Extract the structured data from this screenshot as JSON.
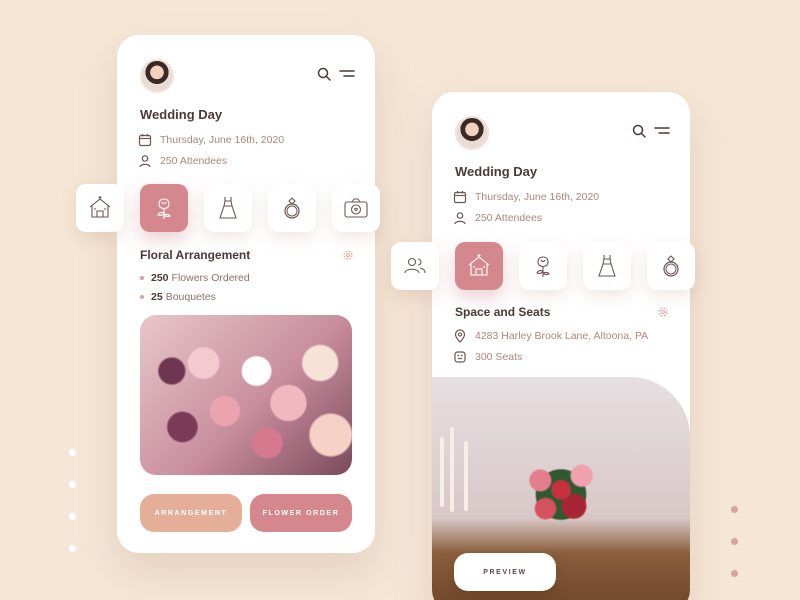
{
  "colors": {
    "background": "#f5e6d6",
    "accent_rose": "#d4888e",
    "accent_peach": "#e5ae98",
    "muted_text": "#a8877f"
  },
  "screen1": {
    "event_title": "Wedding Day",
    "date": "Thursday, June 16th, 2020",
    "attendees": "250 Attendees",
    "categories": [
      {
        "icon": "house-icon",
        "active": false
      },
      {
        "icon": "rose-icon",
        "active": true
      },
      {
        "icon": "dress-icon",
        "active": false
      },
      {
        "icon": "ring-icon",
        "active": false
      },
      {
        "icon": "camera-icon",
        "active": false
      }
    ],
    "section_title": "Floral Arrangement",
    "details": [
      {
        "count": "250",
        "label": "Flowers Ordered"
      },
      {
        "count": "25",
        "label": "Bouquetes"
      }
    ],
    "buttons": {
      "arrangement": "ARRANGEMENT",
      "flower_order": "FLOWER ORDER"
    }
  },
  "screen2": {
    "event_title": "Wedding Day",
    "date": "Thursday, June 16th, 2020",
    "attendees": "250 Attendees",
    "categories": [
      {
        "icon": "people-icon",
        "active": false
      },
      {
        "icon": "house-icon",
        "active": true
      },
      {
        "icon": "rose-icon",
        "active": false
      },
      {
        "icon": "dress-icon",
        "active": false
      },
      {
        "icon": "ring-icon",
        "active": false
      }
    ],
    "section_title": "Space and Seats",
    "address": "4283 Harley Brook Lane, Altoona, PA",
    "seats": "300 Seats",
    "buttons": {
      "preview": "PREVIEW"
    }
  }
}
